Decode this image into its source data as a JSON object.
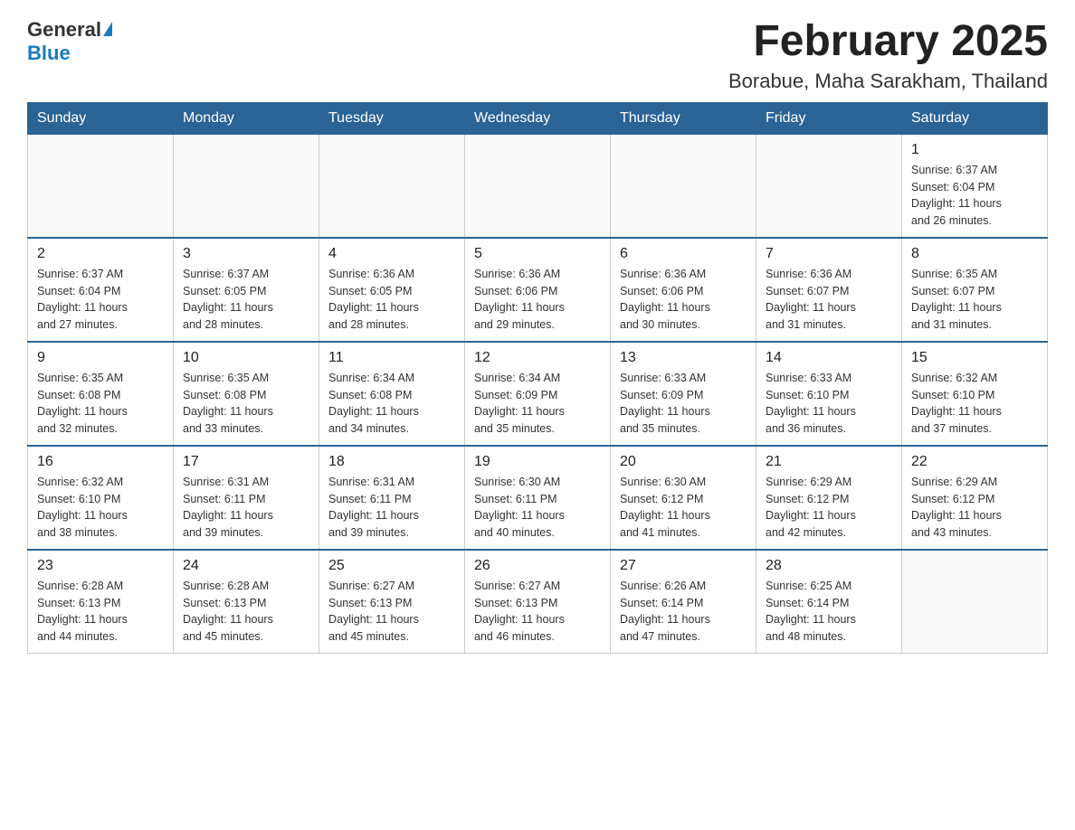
{
  "header": {
    "logo_general": "General",
    "logo_blue": "Blue",
    "title": "February 2025",
    "location": "Borabue, Maha Sarakham, Thailand"
  },
  "weekdays": [
    "Sunday",
    "Monday",
    "Tuesday",
    "Wednesday",
    "Thursday",
    "Friday",
    "Saturday"
  ],
  "weeks": [
    [
      {
        "day": "",
        "info": ""
      },
      {
        "day": "",
        "info": ""
      },
      {
        "day": "",
        "info": ""
      },
      {
        "day": "",
        "info": ""
      },
      {
        "day": "",
        "info": ""
      },
      {
        "day": "",
        "info": ""
      },
      {
        "day": "1",
        "info": "Sunrise: 6:37 AM\nSunset: 6:04 PM\nDaylight: 11 hours\nand 26 minutes."
      }
    ],
    [
      {
        "day": "2",
        "info": "Sunrise: 6:37 AM\nSunset: 6:04 PM\nDaylight: 11 hours\nand 27 minutes."
      },
      {
        "day": "3",
        "info": "Sunrise: 6:37 AM\nSunset: 6:05 PM\nDaylight: 11 hours\nand 28 minutes."
      },
      {
        "day": "4",
        "info": "Sunrise: 6:36 AM\nSunset: 6:05 PM\nDaylight: 11 hours\nand 28 minutes."
      },
      {
        "day": "5",
        "info": "Sunrise: 6:36 AM\nSunset: 6:06 PM\nDaylight: 11 hours\nand 29 minutes."
      },
      {
        "day": "6",
        "info": "Sunrise: 6:36 AM\nSunset: 6:06 PM\nDaylight: 11 hours\nand 30 minutes."
      },
      {
        "day": "7",
        "info": "Sunrise: 6:36 AM\nSunset: 6:07 PM\nDaylight: 11 hours\nand 31 minutes."
      },
      {
        "day": "8",
        "info": "Sunrise: 6:35 AM\nSunset: 6:07 PM\nDaylight: 11 hours\nand 31 minutes."
      }
    ],
    [
      {
        "day": "9",
        "info": "Sunrise: 6:35 AM\nSunset: 6:08 PM\nDaylight: 11 hours\nand 32 minutes."
      },
      {
        "day": "10",
        "info": "Sunrise: 6:35 AM\nSunset: 6:08 PM\nDaylight: 11 hours\nand 33 minutes."
      },
      {
        "day": "11",
        "info": "Sunrise: 6:34 AM\nSunset: 6:08 PM\nDaylight: 11 hours\nand 34 minutes."
      },
      {
        "day": "12",
        "info": "Sunrise: 6:34 AM\nSunset: 6:09 PM\nDaylight: 11 hours\nand 35 minutes."
      },
      {
        "day": "13",
        "info": "Sunrise: 6:33 AM\nSunset: 6:09 PM\nDaylight: 11 hours\nand 35 minutes."
      },
      {
        "day": "14",
        "info": "Sunrise: 6:33 AM\nSunset: 6:10 PM\nDaylight: 11 hours\nand 36 minutes."
      },
      {
        "day": "15",
        "info": "Sunrise: 6:32 AM\nSunset: 6:10 PM\nDaylight: 11 hours\nand 37 minutes."
      }
    ],
    [
      {
        "day": "16",
        "info": "Sunrise: 6:32 AM\nSunset: 6:10 PM\nDaylight: 11 hours\nand 38 minutes."
      },
      {
        "day": "17",
        "info": "Sunrise: 6:31 AM\nSunset: 6:11 PM\nDaylight: 11 hours\nand 39 minutes."
      },
      {
        "day": "18",
        "info": "Sunrise: 6:31 AM\nSunset: 6:11 PM\nDaylight: 11 hours\nand 39 minutes."
      },
      {
        "day": "19",
        "info": "Sunrise: 6:30 AM\nSunset: 6:11 PM\nDaylight: 11 hours\nand 40 minutes."
      },
      {
        "day": "20",
        "info": "Sunrise: 6:30 AM\nSunset: 6:12 PM\nDaylight: 11 hours\nand 41 minutes."
      },
      {
        "day": "21",
        "info": "Sunrise: 6:29 AM\nSunset: 6:12 PM\nDaylight: 11 hours\nand 42 minutes."
      },
      {
        "day": "22",
        "info": "Sunrise: 6:29 AM\nSunset: 6:12 PM\nDaylight: 11 hours\nand 43 minutes."
      }
    ],
    [
      {
        "day": "23",
        "info": "Sunrise: 6:28 AM\nSunset: 6:13 PM\nDaylight: 11 hours\nand 44 minutes."
      },
      {
        "day": "24",
        "info": "Sunrise: 6:28 AM\nSunset: 6:13 PM\nDaylight: 11 hours\nand 45 minutes."
      },
      {
        "day": "25",
        "info": "Sunrise: 6:27 AM\nSunset: 6:13 PM\nDaylight: 11 hours\nand 45 minutes."
      },
      {
        "day": "26",
        "info": "Sunrise: 6:27 AM\nSunset: 6:13 PM\nDaylight: 11 hours\nand 46 minutes."
      },
      {
        "day": "27",
        "info": "Sunrise: 6:26 AM\nSunset: 6:14 PM\nDaylight: 11 hours\nand 47 minutes."
      },
      {
        "day": "28",
        "info": "Sunrise: 6:25 AM\nSunset: 6:14 PM\nDaylight: 11 hours\nand 48 minutes."
      },
      {
        "day": "",
        "info": ""
      }
    ]
  ]
}
